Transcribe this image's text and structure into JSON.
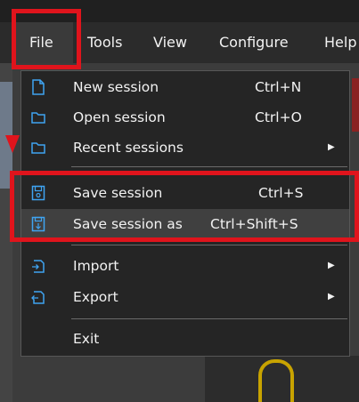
{
  "menubar": {
    "items": [
      {
        "label": "File"
      },
      {
        "label": "Tools"
      },
      {
        "label": "View"
      },
      {
        "label": "Configure"
      },
      {
        "label": "Help"
      }
    ]
  },
  "file_menu": {
    "items": [
      {
        "label": "New session",
        "shortcut": "Ctrl+N",
        "icon": "new-document-icon"
      },
      {
        "label": "Open session",
        "shortcut": "Ctrl+O",
        "icon": "folder-icon"
      },
      {
        "label": "Recent sessions",
        "submenu": true,
        "icon": "folder-icon"
      },
      {
        "label": "Save session",
        "shortcut": "Ctrl+S",
        "icon": "save-icon"
      },
      {
        "label": "Save session as",
        "shortcut": "Ctrl+Shift+S",
        "icon": "save-as-icon",
        "highlighted": true
      },
      {
        "label": "Import",
        "submenu": true,
        "icon": "import-icon"
      },
      {
        "label": "Export",
        "submenu": true,
        "icon": "export-icon"
      },
      {
        "label": "Exit"
      }
    ],
    "submenu_arrow": "▶"
  },
  "colors": {
    "highlight_red": "#e0141c",
    "icon_blue": "#3fa4f2",
    "menu_bg": "#252525"
  }
}
